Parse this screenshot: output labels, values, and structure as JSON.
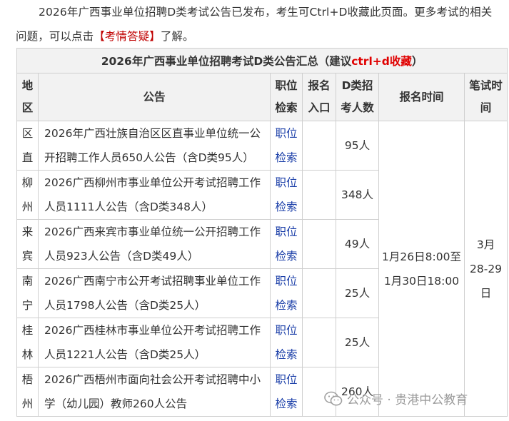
{
  "intro": {
    "line1": "2026年广西事业单位招聘D类考试公告已发布，考生可Ctrl+D收藏此页面。更多考试的相关",
    "line2_prefix": "问题，可以点击",
    "bracket_open": "【",
    "link_text": "考情答疑",
    "bracket_close": "】",
    "line2_suffix": "了解。"
  },
  "table": {
    "title_prefix": "2026年广西事业单位招聘考试D类公告汇总（建议",
    "title_red": "ctrl+d收藏",
    "title_suffix": "）",
    "headers": {
      "region": "地区",
      "notice": "公告",
      "position": "职位检索",
      "signup": "报名入口",
      "count": "D类招考人数",
      "time": "报名时间",
      "exam": "笔试时间"
    },
    "rows": [
      {
        "region": "区直",
        "notice": "2026年广西壮族自治区区直事业单位统一公开招聘工作人员650人公告（含D类95人）",
        "link": "职位检索",
        "count": "95人"
      },
      {
        "region": "柳州",
        "notice": "2026广西柳州市事业单位公开考试招聘工作人员1111人公告（含D类348人）",
        "link": "职位检索",
        "count": "348人"
      },
      {
        "region": "来宾",
        "notice": "2026广西来宾市事业单位统一公开招聘工作人员923人公告（含D类49人）",
        "link": "职位检索",
        "count": "49人"
      },
      {
        "region": "南宁",
        "notice": "2026广西南宁市公开考试招聘事业单位工作人员1798人公告（含D类25人）",
        "link": "职位检索",
        "count": "25人"
      },
      {
        "region": "桂林",
        "notice": "2026广西桂林市事业单位公开考试招聘工作人员1221人公告（含D类25人）",
        "link": "职位检索",
        "count": "25人"
      },
      {
        "region": "梧州",
        "notice": "2026广西梧州市面向社会公开考试招聘中小学（幼儿园）教师260人公告",
        "link": "职位检索",
        "count": "260人"
      }
    ],
    "signup_time": "1月26日8:00至1月30日18:00",
    "exam_time": "3月28-29日"
  },
  "watermark": {
    "text": "公众号 · 贵港中公教育",
    "icon": "wechat-icon"
  }
}
